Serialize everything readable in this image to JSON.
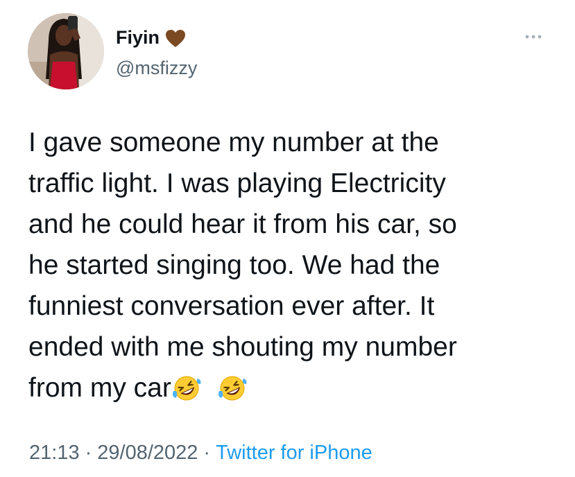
{
  "author": {
    "display_name": "Fiyin",
    "name_emoji": "brown-heart-icon",
    "handle": "@msfizzy",
    "avatar": "profile-photo"
  },
  "menu": {
    "icon": "more-icon"
  },
  "tweet": {
    "lines": [
      "I gave someone my number at the",
      "traffic light. I was playing Electricity",
      "and he could hear it from his car, so",
      "he started singing too. We had the",
      "funniest conversation ever after. It",
      "ended with me shouting my number",
      "from my car"
    ],
    "trailing_emojis": [
      "rolling-on-floor-laughing-icon",
      "rolling-on-floor-laughing-icon"
    ]
  },
  "meta": {
    "time": "21:13",
    "separator": "·",
    "date": "29/08/2022",
    "source": "Twitter for iPhone"
  },
  "colors": {
    "text": "#0f1419",
    "secondary": "#536471",
    "link": "#1d9bf0",
    "heart": "#7b4a22",
    "more_dots": "#a6b0b8"
  }
}
